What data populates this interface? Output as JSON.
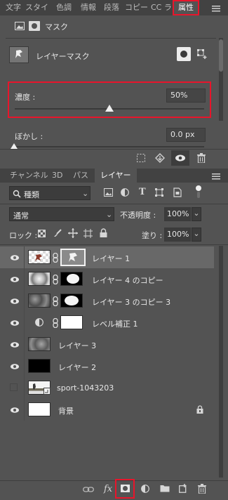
{
  "tabs": [
    {
      "label": "文字"
    },
    {
      "label": "スタイ"
    },
    {
      "label": "色調"
    },
    {
      "label": "情報"
    },
    {
      "label": "段落"
    },
    {
      "label": "コピー"
    },
    {
      "label": "CC ラ"
    },
    {
      "label": "属性"
    }
  ],
  "properties": {
    "title": "マスク",
    "section_title": "レイヤーマスク",
    "density_label": "濃度 :",
    "density_value": "50%",
    "density_percent": 50,
    "feather_label": "ぼかし :",
    "feather_value": "0.0 px"
  },
  "layers_tabs": [
    {
      "label": "チャンネル"
    },
    {
      "label": "3D"
    },
    {
      "label": "パス"
    },
    {
      "label": "レイヤー"
    }
  ],
  "layers_panel": {
    "filter_kind": "種類",
    "blend_mode": "通常",
    "opacity_label": "不透明度 :",
    "opacity_value": "100%",
    "lock_label": "ロック :",
    "fill_label": "塗り :",
    "fill_value": "100%"
  },
  "layers": [
    {
      "name": "レイヤー 1",
      "visible": true,
      "selected": true
    },
    {
      "name": "レイヤー 4 のコピー",
      "visible": true,
      "selected": false
    },
    {
      "name": "レイヤー 3 のコピー 3",
      "visible": true,
      "selected": false
    },
    {
      "name": "レベル補正 1",
      "visible": true,
      "selected": false
    },
    {
      "name": "レイヤー 3",
      "visible": true,
      "selected": false
    },
    {
      "name": "レイヤー 2",
      "visible": true,
      "selected": false
    },
    {
      "name": "sport-1043203",
      "visible": false,
      "selected": false
    },
    {
      "name": "背景",
      "visible": true,
      "selected": false
    }
  ],
  "colors": {
    "highlight": "#e8152b",
    "panel": "#535353",
    "selected_row": "#686868"
  }
}
